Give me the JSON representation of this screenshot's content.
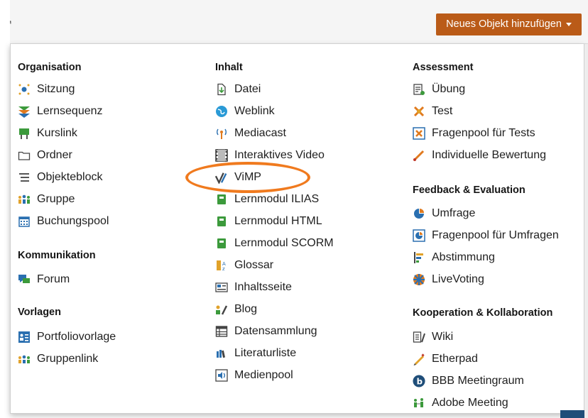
{
  "button": {
    "label": "Neues Objekt hinzufügen"
  },
  "columns": [
    {
      "groups": [
        {
          "heading": "Organisation",
          "items": [
            {
              "label": "Sitzung",
              "icon": "session-icon"
            },
            {
              "label": "Lernsequenz",
              "icon": "learning-sequence-icon"
            },
            {
              "label": "Kurslink",
              "icon": "course-link-icon"
            },
            {
              "label": "Ordner",
              "icon": "folder-icon"
            },
            {
              "label": "Objekteblock",
              "icon": "list-icon"
            },
            {
              "label": "Gruppe",
              "icon": "group-icon"
            },
            {
              "label": "Buchungspool",
              "icon": "calendar-icon"
            }
          ]
        },
        {
          "heading": "Kommunikation",
          "items": [
            {
              "label": "Forum",
              "icon": "forum-icon"
            }
          ]
        },
        {
          "heading": "Vorlagen",
          "items": [
            {
              "label": "Portfoliovorlage",
              "icon": "portfolio-template-icon"
            },
            {
              "label": "Gruppenlink",
              "icon": "group-link-icon"
            }
          ]
        }
      ]
    },
    {
      "groups": [
        {
          "heading": "Inhalt",
          "items": [
            {
              "label": "Datei",
              "icon": "file-icon"
            },
            {
              "label": "Weblink",
              "icon": "weblink-icon"
            },
            {
              "label": "Mediacast",
              "icon": "mediacast-icon"
            },
            {
              "label": "Interaktives Video",
              "icon": "video-icon"
            },
            {
              "label": "ViMP",
              "icon": "vimp-icon"
            },
            {
              "label": "Lernmodul ILIAS",
              "icon": "module-icon"
            },
            {
              "label": "Lernmodul HTML",
              "icon": "module-icon"
            },
            {
              "label": "Lernmodul SCORM",
              "icon": "module-icon"
            },
            {
              "label": "Glossar",
              "icon": "glossary-icon"
            },
            {
              "label": "Inhaltsseite",
              "icon": "content-page-icon"
            },
            {
              "label": "Blog",
              "icon": "blog-icon"
            },
            {
              "label": "Datensammlung",
              "icon": "data-collection-icon"
            },
            {
              "label": "Literaturliste",
              "icon": "bibliography-icon"
            },
            {
              "label": "Medienpool",
              "icon": "media-pool-icon"
            }
          ]
        }
      ]
    },
    {
      "groups": [
        {
          "heading": "Assessment",
          "items": [
            {
              "label": "Übung",
              "icon": "exercise-icon"
            },
            {
              "label": "Test",
              "icon": "test-icon"
            },
            {
              "label": "Fragenpool für Tests",
              "icon": "question-pool-icon"
            },
            {
              "label": "Individuelle Bewertung",
              "icon": "assessment-icon"
            }
          ]
        },
        {
          "heading": "Feedback & Evaluation",
          "items": [
            {
              "label": "Umfrage",
              "icon": "survey-icon"
            },
            {
              "label": "Fragenpool für Umfragen",
              "icon": "survey-pool-icon"
            },
            {
              "label": "Abstimmung",
              "icon": "poll-icon"
            },
            {
              "label": "LiveVoting",
              "icon": "livevoting-icon"
            }
          ]
        },
        {
          "heading": "Kooperation & Kollaboration",
          "items": [
            {
              "label": "Wiki",
              "icon": "wiki-icon"
            },
            {
              "label": "Etherpad",
              "icon": "etherpad-icon"
            },
            {
              "label": "BBB Meetingraum",
              "icon": "bbb-icon"
            },
            {
              "label": "Adobe Meeting",
              "icon": "adobe-meeting-icon"
            }
          ]
        }
      ]
    }
  ],
  "colors": {
    "button": "#ba5b18",
    "highlight": "#f07a1e",
    "green": "#3c9a3c"
  }
}
